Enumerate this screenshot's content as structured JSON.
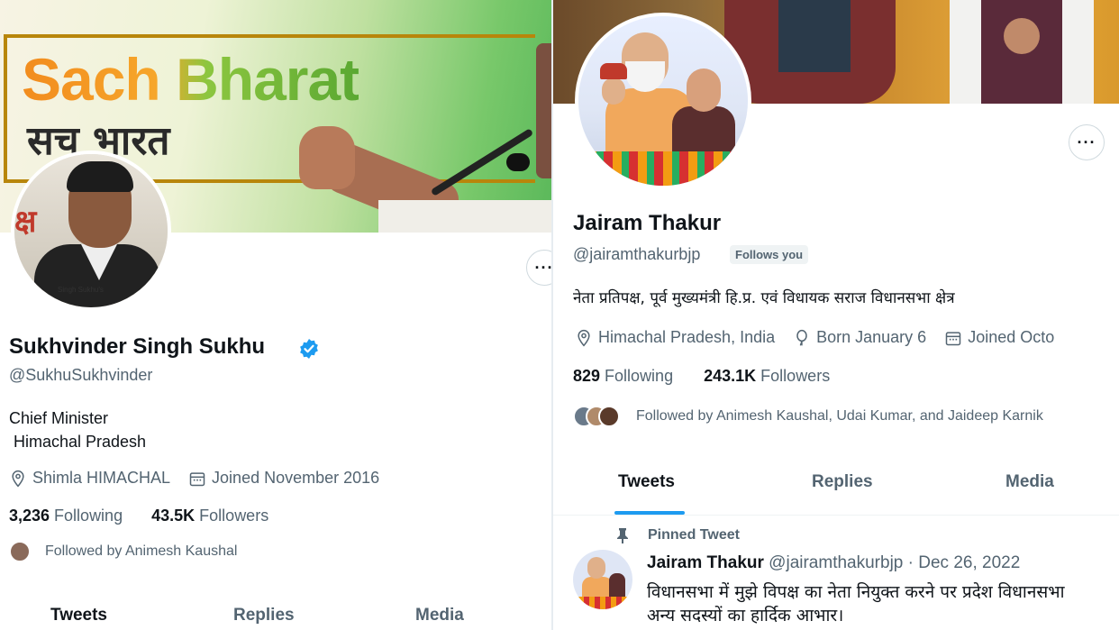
{
  "left_profile": {
    "banner": {
      "title": "Sach Bharat",
      "subtitle": "सच भारत"
    },
    "name": "Sukhvinder Singh Sukhu",
    "verified": true,
    "handle": "@SukhuSukhvinder",
    "bio_line1": "Chief Minister",
    "bio_line2": " Himachal Pradesh",
    "location": "Shimla HIMACHAL",
    "joined": "Joined November 2016",
    "following_count": "3,236",
    "following_label": " Following",
    "followers_count": "43.5K",
    "followers_label": " Followers",
    "followed_by": "Followed by Animesh Kaushal",
    "more_label": "···",
    "tabs": [
      "Tweets",
      "Replies",
      "Media"
    ],
    "avatar_poster_text": "क्ष",
    "avatar_tag": "Singh Sukhu's"
  },
  "right_profile": {
    "name": "Jairam Thakur",
    "handle": "@jairamthakurbjp",
    "follows_you": "Follows you",
    "bio": "नेता प्रतिपक्ष, पूर्व मुख्यमंत्री हि.प्र. एवं विधायक सराज विधानसभा क्षेत्र",
    "location": "Himachal Pradesh, India",
    "born": "Born January 6",
    "joined": "Joined Octo",
    "following_count": "829",
    "following_label": " Following",
    "followers_count": "243.1K",
    "followers_label": " Followers",
    "followed_by": "Followed by Animesh Kaushal, Udai Kumar, and Jaideep Karnik",
    "more_label": "···",
    "tabs": [
      "Tweets",
      "Replies",
      "Media"
    ],
    "pinned_label": "Pinned Tweet",
    "tweet": {
      "author": "Jairam Thakur",
      "handle": " @jairamthakurbjp",
      "date": " · Dec 26, 2022",
      "line1": "विधानसभा में मुझे विपक्ष का नेता नियुक्त करने पर प्रदेश विधानसभा",
      "line2": "अन्य सदस्यों का हार्दिक आभार।"
    }
  },
  "colors": {
    "accent": "#1d9bf0",
    "text": "#0f1419",
    "secondary": "#536471",
    "verified": "#1d9bf0"
  },
  "icons": [
    "location-icon",
    "calendar-icon",
    "birthday-icon",
    "verified-badge-icon",
    "pin-icon",
    "more-icon"
  ]
}
